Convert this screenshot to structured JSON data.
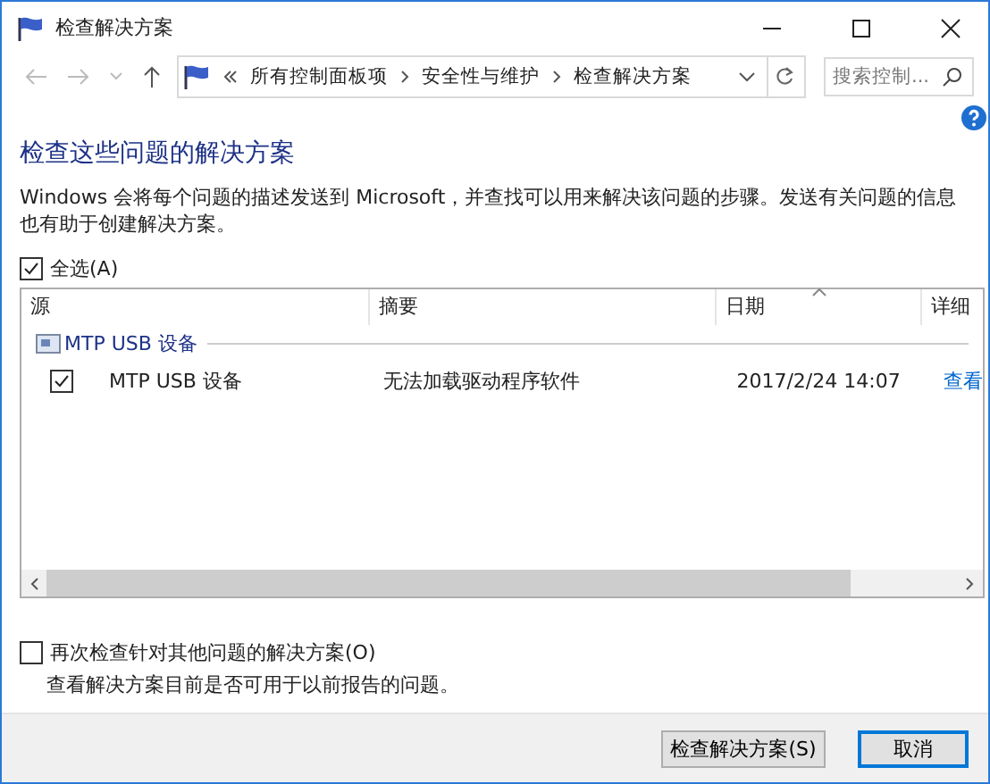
{
  "window": {
    "title": "检查解决方案"
  },
  "address": {
    "breadcrumbs": [
      "所有控制面板项",
      "安全性与维护",
      "检查解决方案"
    ],
    "search": {
      "placeholder": "搜索控制..."
    }
  },
  "heading": "检查这些问题的解决方案",
  "description": "Windows 会将每个问题的描述发送到 Microsoft，并查找可以用来解决该问题的步骤。发送有关问题的信息也有助于创建解决方案。",
  "select_all": {
    "label": "全选(A)",
    "checked": true
  },
  "table": {
    "columns": [
      "源",
      "摘要",
      "日期",
      "详细"
    ],
    "groups": [
      {
        "name": "MTP USB 设备",
        "rows": [
          {
            "source": "MTP USB 设备",
            "summary": "无法加载驱动程序软件",
            "date": "2017/2/24 14:07",
            "details": "查看",
            "checked": true
          }
        ]
      }
    ]
  },
  "recheck": {
    "label": "再次检查针对其他问题的解决方案(O)",
    "note": "查看解决方案目前是否可用于以前报告的问题。",
    "checked": false
  },
  "buttons": [
    {
      "label": "检查解决方案(S)",
      "default": false
    },
    {
      "label": "取消",
      "default": true
    }
  ]
}
